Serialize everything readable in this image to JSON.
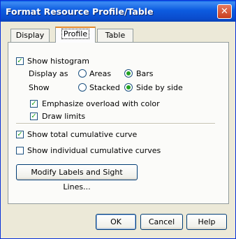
{
  "window": {
    "title": "Format Resource Profile/Table",
    "close_glyph": "✕"
  },
  "tabs": [
    {
      "label": "Display",
      "active": false
    },
    {
      "label": "Profile",
      "active": true
    },
    {
      "label": "Table",
      "active": false
    }
  ],
  "profile": {
    "show_histogram": {
      "label": "Show histogram",
      "checked": true
    },
    "display_as": {
      "label": "Display as",
      "options": [
        "Areas",
        "Bars"
      ],
      "selected": "Bars"
    },
    "show": {
      "label": "Show",
      "options": [
        "Stacked",
        "Side by side"
      ],
      "selected": "Side by side"
    },
    "emphasize_overload": {
      "label": "Emphasize overload with color",
      "checked": true
    },
    "draw_limits": {
      "label": "Draw limits",
      "checked": true
    },
    "show_total_cumulative": {
      "label": "Show total cumulative curve",
      "checked": true
    },
    "show_individual_cumulative": {
      "label": "Show individual cumulative curves",
      "checked": false
    },
    "modify_button": "Modify Labels and Sight Lines..."
  },
  "buttons": {
    "ok": "OK",
    "cancel": "Cancel",
    "help": "Help"
  }
}
